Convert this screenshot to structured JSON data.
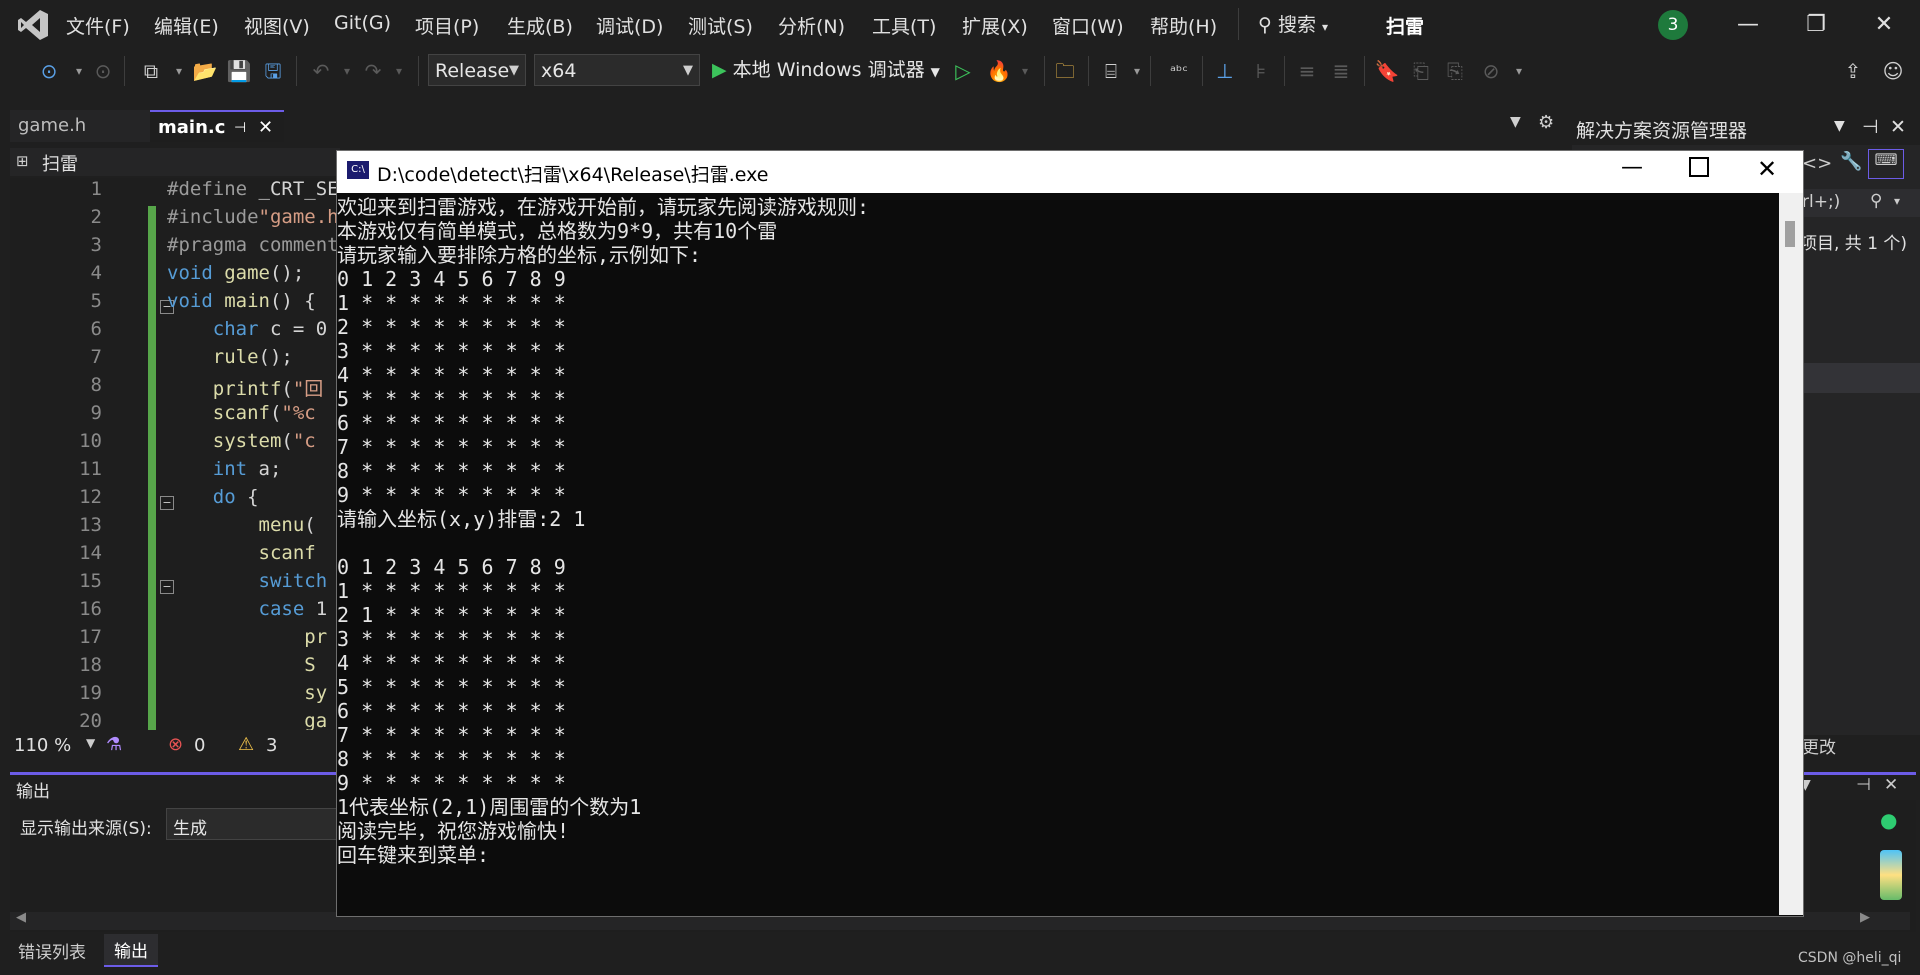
{
  "menubar": {
    "items": [
      "文件(F)",
      "编辑(E)",
      "视图(V)",
      "Git(G)",
      "项目(P)",
      "生成(B)",
      "调试(D)",
      "测试(S)",
      "分析(N)",
      "工具(T)",
      "扩展(X)",
      "窗口(W)",
      "帮助(H)"
    ],
    "search_label": "搜索",
    "project_title": "扫雷",
    "notification_count": "3"
  },
  "toolbar": {
    "config": "Release",
    "platform": "x64",
    "run_label": "本地 Windows 调试器"
  },
  "tabs": {
    "inactive": "game.h",
    "active": "main.c"
  },
  "editor": {
    "nav_project": "扫雷",
    "line_numbers": [
      "1",
      "2",
      "3",
      "4",
      "5",
      "6",
      "7",
      "8",
      "9",
      "10",
      "11",
      "12",
      "13",
      "14",
      "15",
      "16",
      "17",
      "18",
      "19",
      "20"
    ],
    "zoom": "110 %",
    "errors": "0",
    "warnings": "3"
  },
  "solution_explorer": {
    "title": "解决方案资源管理器",
    "search_hint": "rl+;)",
    "summary": "项目, 共 1 个)",
    "footer_text": "更改"
  },
  "output": {
    "title": "输出",
    "source_label": "显示输出来源(S):",
    "source_value": "生成"
  },
  "bottom_tabs": [
    "错误列表",
    "输出"
  ],
  "console": {
    "title": "D:\\code\\detect\\扫雷\\x64\\Release\\扫雷.exe",
    "lines": [
      "欢迎来到扫雷游戏，在游戏开始前，请玩家先阅读游戏规则:",
      "本游戏仅有简单模式，总格数为9*9，共有10个雷",
      "请玩家输入要排除方格的坐标,示例如下:",
      "0 1 2 3 4 5 6 7 8 9",
      "1 * * * * * * * * *",
      "2 * * * * * * * * *",
      "3 * * * * * * * * *",
      "4 * * * * * * * * *",
      "5 * * * * * * * * *",
      "6 * * * * * * * * *",
      "7 * * * * * * * * *",
      "8 * * * * * * * * *",
      "9 * * * * * * * * *",
      "请输入坐标(x,y)排雷:2 1",
      "",
      "0 1 2 3 4 5 6 7 8 9",
      "1 * * * * * * * * *",
      "2 1 * * * * * * * *",
      "3 * * * * * * * * *",
      "4 * * * * * * * * *",
      "5 * * * * * * * * *",
      "6 * * * * * * * * *",
      "7 * * * * * * * * *",
      "8 * * * * * * * * *",
      "9 * * * * * * * * *",
      "1代表坐标(2,1)周围雷的个数为1",
      "阅读完毕，祝您游戏愉快!",
      "回车键来到菜单:"
    ]
  },
  "watermark": "CSDN @heli_qi",
  "colors": {
    "accent": "#6c5ce7",
    "console_bg": "#0c0c0c",
    "keyword": "#569cd6",
    "change_bar": "#57a64a"
  }
}
